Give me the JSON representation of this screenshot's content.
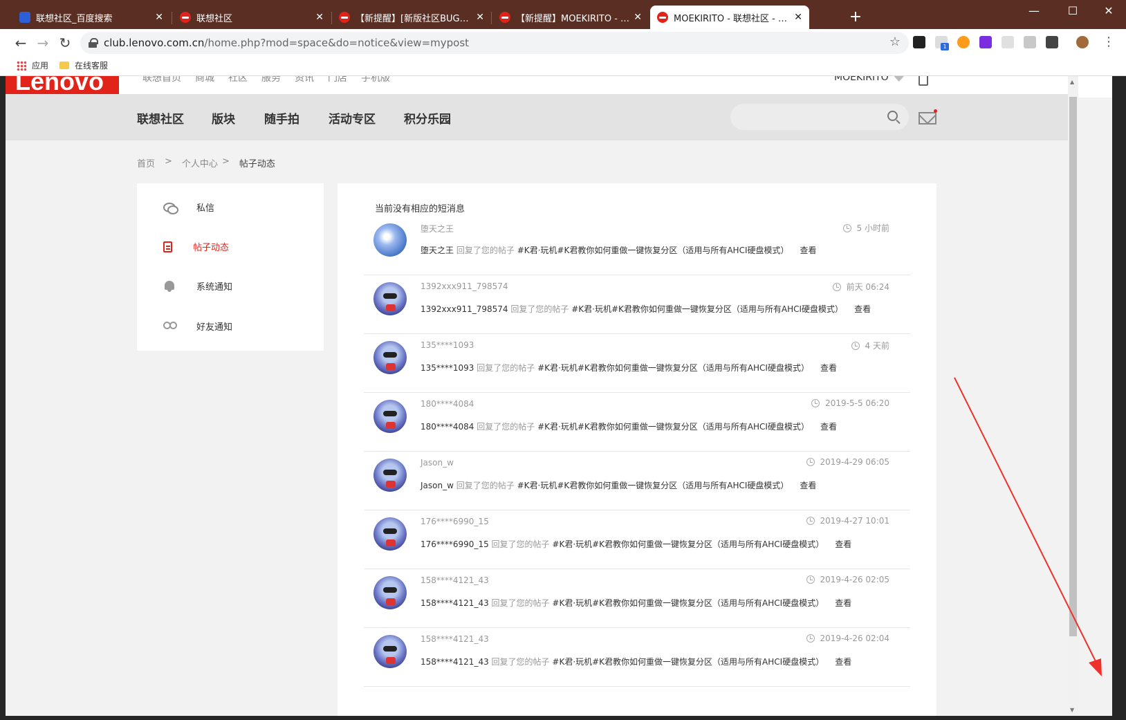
{
  "browser": {
    "tabs": [
      {
        "title": "联想社区_百度搜索",
        "favicon": "baidu"
      },
      {
        "title": "联想社区",
        "favicon": "lenovo"
      },
      {
        "title": "【新提醒】[新版社区BUG反馈]論",
        "favicon": "lenovo"
      },
      {
        "title": "【新提醒】MOEKIRITO - 联想社",
        "favicon": "lenovo"
      },
      {
        "title": "MOEKIRITO - 联想社区 - Power",
        "favicon": "lenovo",
        "active": true
      }
    ],
    "url_host": "club.lenovo.com.cn",
    "url_path": "/home.php?mod=space&do=notice&view=mypost",
    "bookmarks": [
      "应用",
      "在线客服"
    ],
    "extension_badge": "1"
  },
  "site": {
    "logo": "Lenovo",
    "top_links": [
      "联想首页",
      "商城",
      "社区",
      "服务",
      "资讯",
      "门店",
      "手机版"
    ],
    "username": "MOEKIRITO",
    "main_nav": [
      "联想社区",
      "版块",
      "随手拍",
      "活动专区",
      "积分乐园"
    ],
    "search_placeholder": ""
  },
  "breadcrumb": [
    "首页",
    "个人中心",
    "帖子动态"
  ],
  "sidebar": [
    {
      "label": "私信",
      "icon": "chat-icon"
    },
    {
      "label": "帖子动态",
      "icon": "post-icon",
      "active": true
    },
    {
      "label": "系统通知",
      "icon": "bell-icon"
    },
    {
      "label": "好友通知",
      "icon": "friends-icon"
    }
  ],
  "content": {
    "empty_message": "当前没有相应的短消息",
    "notices": [
      {
        "user": "堕天之王",
        "time": "5 小时前",
        "action": "回复了您的帖子",
        "subject": "#K君·玩机#K君教你如何重做一键恢复分区（适用与所有AHCI硬盘模式）",
        "view": "查看",
        "avatar": "sky"
      },
      {
        "user": "1392xxx911_798574",
        "time": "前天 06:24",
        "action": "回复了您的帖子",
        "subject": "#K君·玩机#K君教你如何重做一键恢复分区（适用与所有AHCI硬盘模式）",
        "view": "查看",
        "avatar": "toon"
      },
      {
        "user": "135****1093",
        "time": "4 天前",
        "action": "回复了您的帖子",
        "subject": "#K君·玩机#K君教你如何重做一键恢复分区（适用与所有AHCI硬盘模式）",
        "view": "查看",
        "avatar": "toon"
      },
      {
        "user": "180****4084",
        "time": "2019-5-5 06:20",
        "action": "回复了您的帖子",
        "subject": "#K君·玩机#K君教你如何重做一键恢复分区（适用与所有AHCI硬盘模式）",
        "view": "查看",
        "avatar": "toon"
      },
      {
        "user": "Jason_w",
        "time": "2019-4-29 06:05",
        "action": "回复了您的帖子",
        "subject": "#K君·玩机#K君教你如何重做一键恢复分区（适用与所有AHCI硬盘模式）",
        "view": "查看",
        "avatar": "toon"
      },
      {
        "user": "176****6990_15",
        "time": "2019-4-27 10:01",
        "action": "回复了您的帖子",
        "subject": "#K君·玩机#K君教你如何重做一键恢复分区（适用与所有AHCI硬盘模式）",
        "view": "查看",
        "avatar": "toon"
      },
      {
        "user": "158****4121_43",
        "time": "2019-4-26 02:05",
        "action": "回复了您的帖子",
        "subject": "#K君·玩机#K君教你如何重做一键恢复分区（适用与所有AHCI硬盘模式）",
        "view": "查看",
        "avatar": "toon"
      },
      {
        "user": "158****4121_43",
        "time": "2019-4-26 02:04",
        "action": "回复了您的帖子",
        "subject": "#K君·玩机#K君教你如何重做一键恢复分区（适用与所有AHCI硬盘模式）",
        "view": "查看",
        "avatar": "toon"
      }
    ]
  },
  "colors": {
    "accent": "#e2231a",
    "tabbar": "#5a2e22",
    "annotation_arrow": "#f0302a"
  }
}
